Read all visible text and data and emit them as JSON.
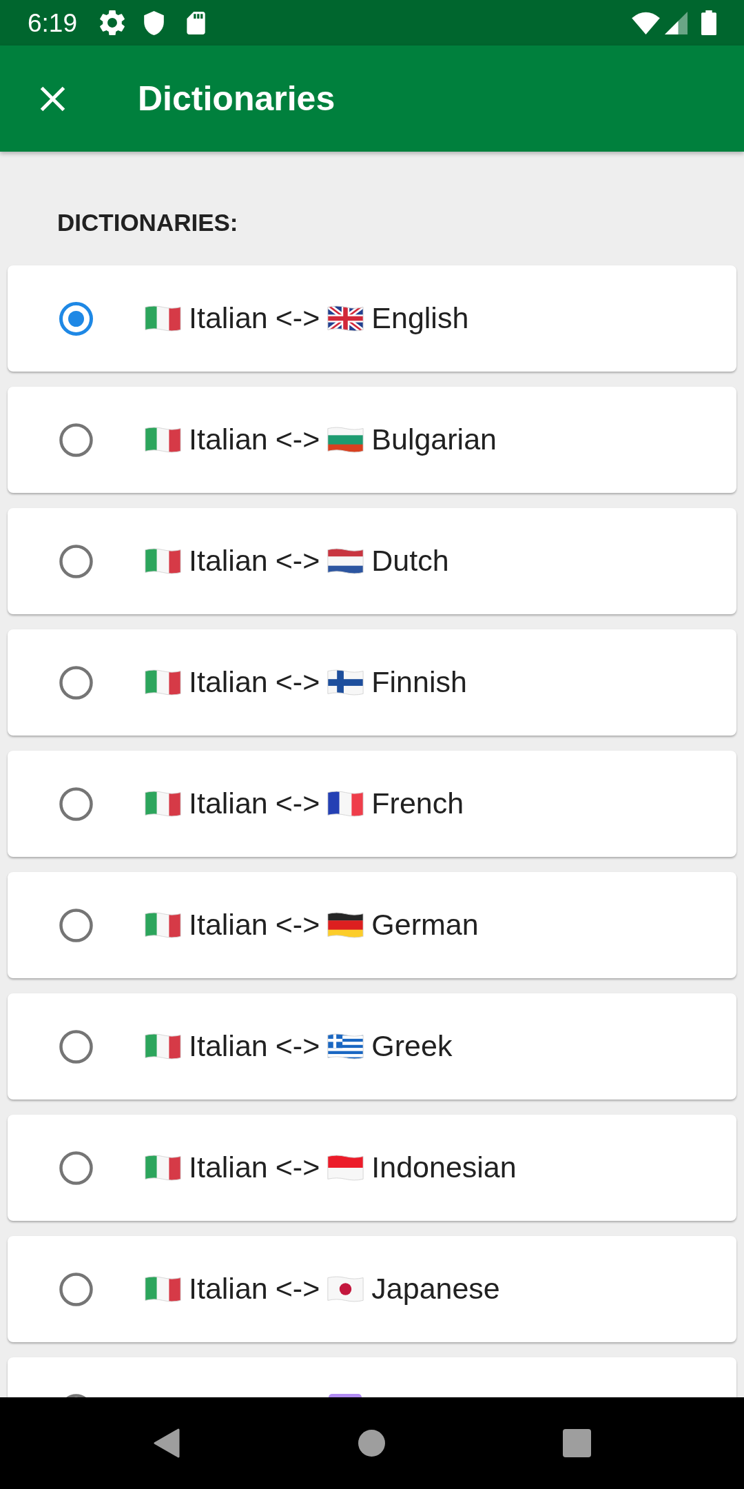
{
  "status_bar": {
    "time": "6:19"
  },
  "app_bar": {
    "title": "Dictionaries"
  },
  "section_header": "DICTIONARIES:",
  "dictionaries": [
    {
      "selected": true,
      "source": {
        "kind": "italy",
        "name": "Italian"
      },
      "separator": "<->",
      "target": {
        "kind": "uk",
        "name": "English"
      }
    },
    {
      "selected": false,
      "source": {
        "kind": "italy",
        "name": "Italian"
      },
      "separator": "<->",
      "target": {
        "kind": "bulgaria",
        "name": "Bulgarian"
      }
    },
    {
      "selected": false,
      "source": {
        "kind": "italy",
        "name": "Italian"
      },
      "separator": "<->",
      "target": {
        "kind": "netherlands",
        "name": "Dutch"
      }
    },
    {
      "selected": false,
      "source": {
        "kind": "italy",
        "name": "Italian"
      },
      "separator": "<->",
      "target": {
        "kind": "finland",
        "name": "Finnish"
      }
    },
    {
      "selected": false,
      "source": {
        "kind": "italy",
        "name": "Italian"
      },
      "separator": "<->",
      "target": {
        "kind": "france",
        "name": "French"
      }
    },
    {
      "selected": false,
      "source": {
        "kind": "italy",
        "name": "Italian"
      },
      "separator": "<->",
      "target": {
        "kind": "germany",
        "name": "German"
      }
    },
    {
      "selected": false,
      "source": {
        "kind": "italy",
        "name": "Italian"
      },
      "separator": "<->",
      "target": {
        "kind": "greece",
        "name": "Greek"
      }
    },
    {
      "selected": false,
      "source": {
        "kind": "italy",
        "name": "Italian"
      },
      "separator": "<->",
      "target": {
        "kind": "indonesia",
        "name": "Indonesian"
      }
    },
    {
      "selected": false,
      "source": {
        "kind": "italy",
        "name": "Italian"
      },
      "separator": "<->",
      "target": {
        "kind": "japan",
        "name": "Japanese"
      }
    },
    {
      "selected": false,
      "target": {
        "kind": "square"
      }
    }
  ]
}
